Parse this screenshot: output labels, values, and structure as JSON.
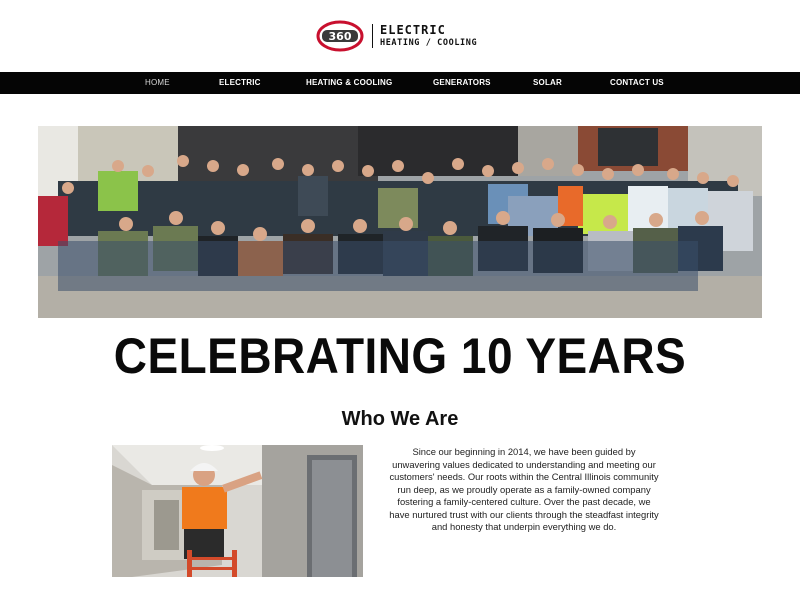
{
  "brand": {
    "logo_number": "360",
    "line1": "ELECTRIC",
    "line2": "HEATING / COOLING",
    "colors": {
      "ring": "#c8102e",
      "badge": "#9a9a9a",
      "text": "#111111"
    }
  },
  "nav": {
    "items": [
      {
        "label": "HOME",
        "active": true
      },
      {
        "label": "ELECTRIC",
        "active": false
      },
      {
        "label": "HEATING & COOLING",
        "active": false
      },
      {
        "label": "GENERATORS",
        "active": false
      },
      {
        "label": "SOLAR",
        "active": false
      },
      {
        "label": "CONTACT US",
        "active": false
      }
    ],
    "background": "#050505"
  },
  "hero": {
    "image_alt": "Team photo of staff in front of the company building"
  },
  "headline": "CELEBRATING 10 YEARS",
  "about": {
    "title": "Who We Are",
    "image_alt": "Electrician in orange shirt and hard hat working in a hallway on a ladder",
    "text": "Since our beginning in 2014, we have been guided by unwavering values dedicated to understanding and meeting our customers' needs. Our roots within the Central Illinois community run deep, as we proudly operate as a family-owned company fostering a family-centered culture. Over the past decade, we have nurtured trust with our clients through the steadfast integrity and honesty that underpin everything we do."
  }
}
